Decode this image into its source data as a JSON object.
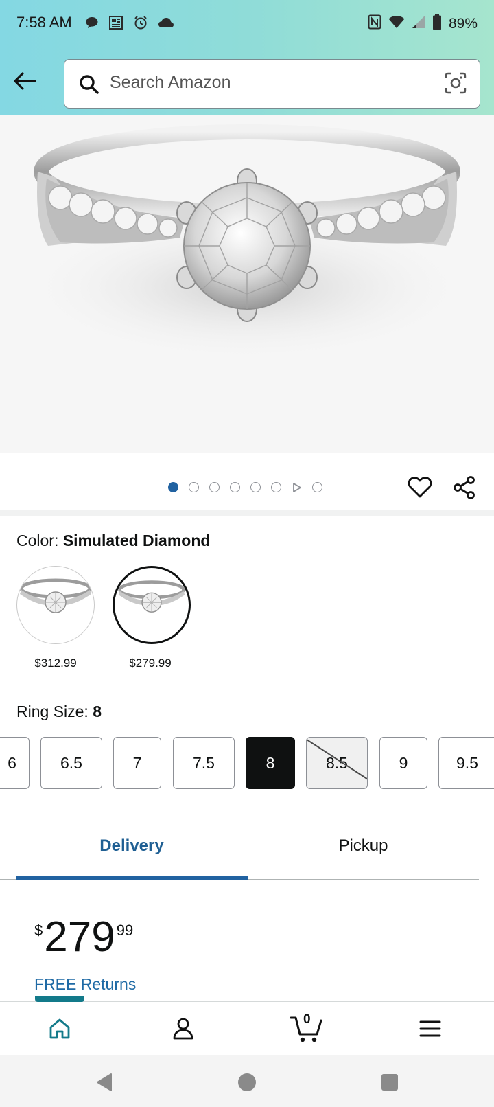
{
  "status_bar": {
    "time": "7:58 AM",
    "battery": "89%",
    "icons": [
      "chat-icon",
      "news-icon",
      "alarm-icon",
      "cloud-icon",
      "nfc-icon",
      "wifi-icon",
      "signal-icon",
      "battery-icon"
    ]
  },
  "search": {
    "placeholder": "Search Amazon"
  },
  "carousel": {
    "image_count": 8,
    "active_index": 0
  },
  "color": {
    "label": "Color:",
    "selected": "Simulated Diamond",
    "options": [
      {
        "price": "$312.99",
        "selected": false
      },
      {
        "price": "$279.99",
        "selected": true
      }
    ]
  },
  "ring_size": {
    "label": "Ring Size:",
    "selected": "8",
    "options": [
      "6",
      "6.5",
      "7",
      "7.5",
      "8",
      "8.5",
      "9",
      "9.5"
    ],
    "unavailable": [
      "8.5"
    ]
  },
  "tabs": {
    "delivery": "Delivery",
    "pickup": "Pickup",
    "active": "Delivery"
  },
  "price": {
    "currency": "$",
    "whole": "279",
    "fraction": "99"
  },
  "free_returns": "FREE Returns",
  "bottom_nav": {
    "cart_count": "0",
    "active": "home"
  },
  "colors": {
    "accent_blue": "#2162a1",
    "link_blue": "#1f6aa5",
    "teal": "#137a8a",
    "header_gradient_start": "#84d8e3",
    "header_gradient_end": "#a6e5ce"
  }
}
